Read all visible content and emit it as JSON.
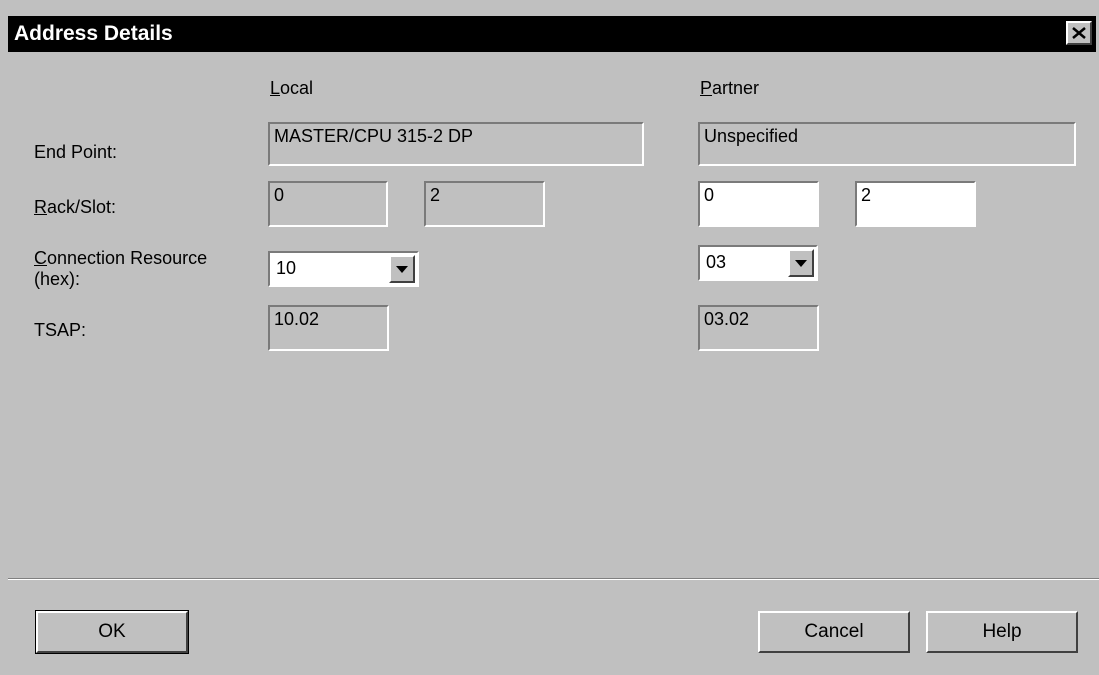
{
  "window": {
    "title": "Address Details"
  },
  "columns": {
    "local": "Local",
    "partner": "Partner"
  },
  "labels": {
    "end_point": "End Point:",
    "rack_slot": "Rack/Slot:",
    "connection_resource_line1": "Connection Resource",
    "connection_resource_line2": "(hex):",
    "tsap": "TSAP:"
  },
  "local": {
    "end_point": "MASTER/CPU 315-2 DP",
    "rack": "0",
    "slot": "2",
    "connection_resource": "10",
    "tsap": "10.02"
  },
  "partner": {
    "end_point": "Unspecified",
    "rack": "0",
    "slot": "2",
    "connection_resource": "03",
    "tsap": "03.02"
  },
  "buttons": {
    "ok": "OK",
    "cancel": "Cancel",
    "help": "Help"
  },
  "colors": {
    "dialog_bg": "#c0c0c0",
    "titlebar_bg": "#000000"
  }
}
